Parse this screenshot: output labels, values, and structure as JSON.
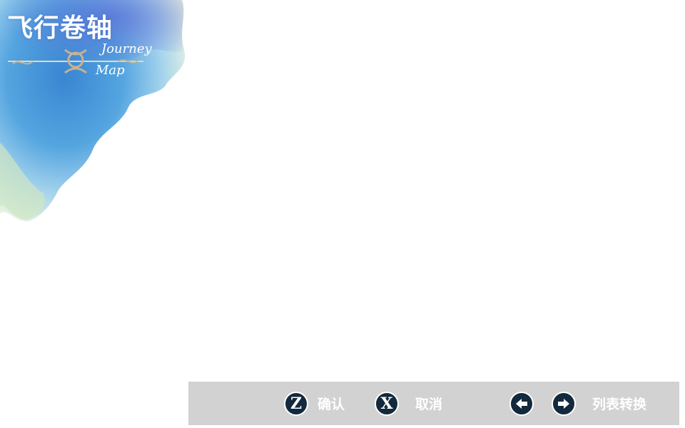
{
  "logo": {
    "title": "飞行卷轴",
    "subtitle_line1": "Journey",
    "subtitle_line2": "Map"
  },
  "controls": {
    "confirm": {
      "key": "Z",
      "label": "确认"
    },
    "cancel": {
      "key": "X",
      "label": "取消"
    },
    "switch_list": {
      "label": "列表转换",
      "left_icon": "arrow-left-icon",
      "right_icon": "arrow-right-icon"
    }
  },
  "colors": {
    "bar_background": "#d2d2d2",
    "key_circle": "#13293d",
    "text": "#ffffff",
    "watercolor_blue": "#3a8ad6",
    "watercolor_light": "#9fd0ec"
  }
}
